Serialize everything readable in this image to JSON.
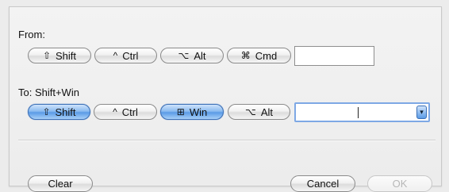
{
  "from": {
    "label": "From:",
    "modifiers": [
      {
        "symbol": "⇧",
        "label": "Shift"
      },
      {
        "symbol": "^",
        "label": "Ctrl"
      },
      {
        "symbol": "⌥",
        "label": "Alt"
      },
      {
        "symbol": "⌘",
        "label": "Cmd"
      }
    ],
    "key_value": ""
  },
  "to": {
    "label": "To: Shift+Win",
    "modifiers": [
      {
        "symbol": "⇧",
        "label": "Shift",
        "active": true
      },
      {
        "symbol": "^",
        "label": "Ctrl",
        "active": false
      },
      {
        "symbol": "⊞",
        "label": "Win",
        "active": true
      },
      {
        "symbol": "⌥",
        "label": "Alt",
        "active": false
      }
    ],
    "key_value": "",
    "dropdown_icon": "chevron-down-icon"
  },
  "buttons": {
    "clear": "Clear",
    "cancel": "Cancel",
    "ok": "OK"
  },
  "colors": {
    "active_accent": "#5a9be6",
    "combo_border": "#7ea8e5"
  }
}
